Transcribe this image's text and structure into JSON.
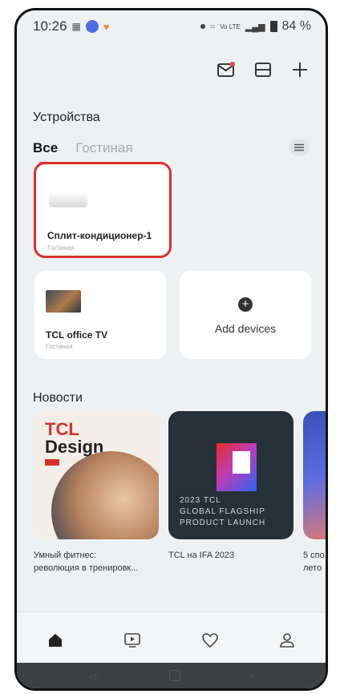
{
  "status": {
    "time": "10:26",
    "battery": "84 %",
    "network": "Vo LTE"
  },
  "header": {
    "actions": [
      "mail-icon",
      "scan-icon",
      "add-icon"
    ]
  },
  "devices": {
    "section_title": "Устройства",
    "tabs": [
      {
        "label": "Все",
        "active": true
      },
      {
        "label": "Гостиная",
        "active": false
      }
    ],
    "cards": [
      {
        "name": "Сплит-кондиционер-1",
        "room": "Гостиная",
        "highlighted": true
      },
      {
        "name": "TCL office TV",
        "room": "Гостиная"
      }
    ],
    "add_label": "Add devices"
  },
  "news": {
    "section_title": "Новости",
    "items": [
      {
        "caption_line1": "Умный фитнес:",
        "caption_line2": "революция в тренировк...",
        "brand": "TCL",
        "brand_sub": "Design"
      },
      {
        "caption_line1": "TCL на IFA 2023",
        "text1": "2023 TCL",
        "text2": "GLOBAL FLAGSHIP",
        "text3": "PRODUCT LAUNCH"
      },
      {
        "caption_line1": "5 спо",
        "caption_line2": "лето"
      }
    ]
  },
  "colors": {
    "accent": "#e84a3d",
    "highlight": "#d9312f"
  },
  "nav": {
    "items": [
      "home-icon",
      "media-icon",
      "heart-icon",
      "profile-icon"
    ]
  }
}
